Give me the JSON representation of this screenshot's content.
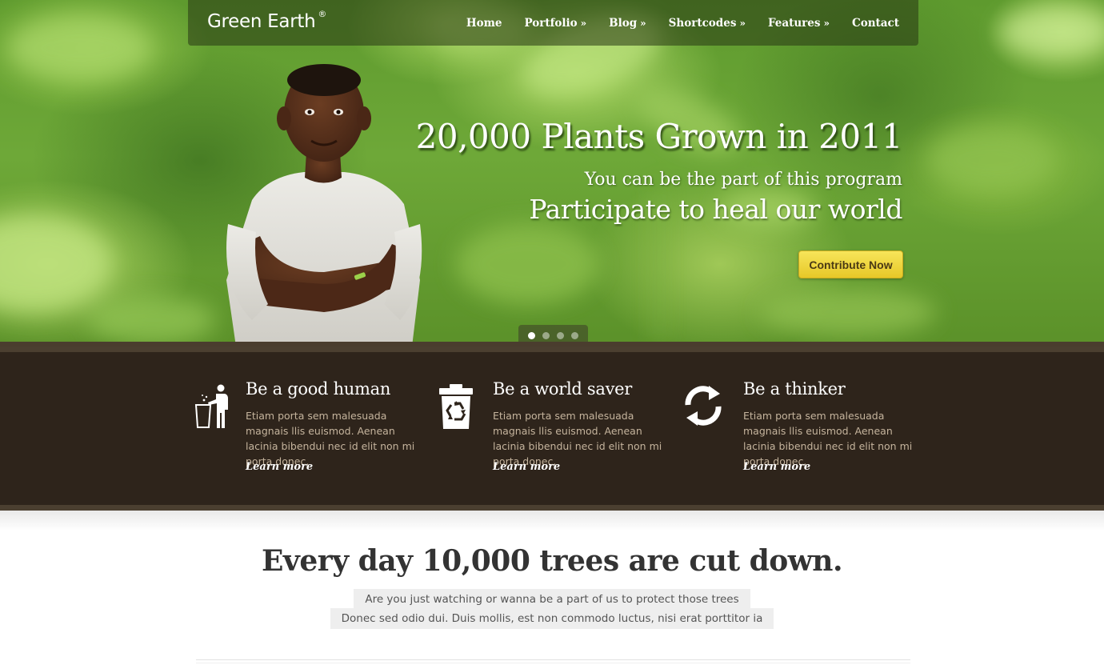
{
  "brand": {
    "name": "Green Earth",
    "mark": "®"
  },
  "nav": {
    "items": [
      {
        "label": "Home",
        "has_submenu": false
      },
      {
        "label": "Portfolio",
        "has_submenu": true
      },
      {
        "label": "Blog",
        "has_submenu": true
      },
      {
        "label": "Shortcodes",
        "has_submenu": true
      },
      {
        "label": "Features",
        "has_submenu": true
      },
      {
        "label": "Contact",
        "has_submenu": false
      }
    ],
    "submenu_glyph": "»"
  },
  "hero": {
    "title": "20,000 Plants Grown in 2011",
    "subtitle": "You can be the part of this program",
    "tagline": "Participate to heal our world",
    "cta_label": "Contribute Now",
    "slides_total": 4,
    "slide_active": 1
  },
  "features": [
    {
      "icon": "person-trash-icon",
      "title": "Be a good human",
      "text": "Etiam porta sem malesuada magnais llis euismod. Aenean lacinia bibendui nec id elit non mi porta donec.",
      "link": "Learn more"
    },
    {
      "icon": "recycle-bin-icon",
      "title": "Be a world saver",
      "text": "Etiam porta sem malesuada magnais llis euismod. Aenean lacinia bibendui nec id elit non mi porta donec.",
      "link": "Learn more"
    },
    {
      "icon": "refresh-arrows-icon",
      "title": "Be a thinker",
      "text": "Etiam porta sem malesuada magnais llis euismod. Aenean lacinia bibendui nec id elit non mi porta donec.",
      "link": "Learn more"
    }
  ],
  "callout": {
    "headline": "Every day 10,000 trees are cut down.",
    "line1": "Are you just watching or wanna be a part of us to protect those trees",
    "line2": "Donec sed odio dui. Duis mollis, est non commodo luctus, nisi erat porttitor ia"
  },
  "colors": {
    "hero_green": "#6ea838",
    "band_brown": "#2e241b",
    "cta_yellow": "#f0d640",
    "feature_text": "#c5b49d"
  }
}
